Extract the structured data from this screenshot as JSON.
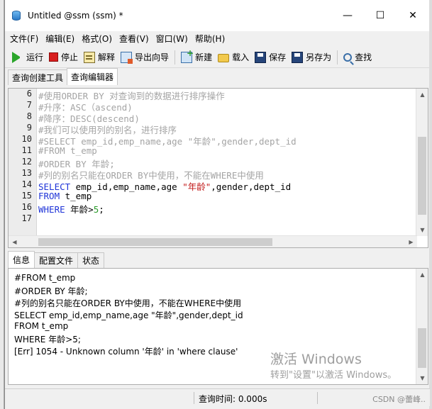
{
  "window": {
    "title": "Untitled @ssm (ssm) *",
    "minimize": "—",
    "maximize": "☐",
    "close": "✕"
  },
  "menu": [
    "文件(F)",
    "编辑(E)",
    "格式(O)",
    "查看(V)",
    "窗口(W)",
    "帮助(H)"
  ],
  "toolbar": {
    "run": "运行",
    "stop": "停止",
    "explain": "解释",
    "export_wizard": "导出向导",
    "new": "新建",
    "load": "载入",
    "save": "保存",
    "save_as": "另存为",
    "find": "查找"
  },
  "tabs": [
    "查询创建工具",
    "查询编辑器"
  ],
  "active_tab": "查询编辑器",
  "editor": {
    "lines": [
      {
        "no": "6",
        "text": "#使用ORDER BY 对查询到的数据进行排序操作"
      },
      {
        "no": "7",
        "text": "#升序：ASC（ascend)"
      },
      {
        "no": "8",
        "text": "#降序：DESC(descend)"
      },
      {
        "no": "9",
        "text": "#我们可以使用列的别名，进行排序"
      },
      {
        "no": "10",
        "text": "#SELECT emp_id,emp_name,age \"年龄\",gender,dept_id"
      },
      {
        "no": "11",
        "text": "#FROM t_emp"
      },
      {
        "no": "12",
        "text": "#ORDER BY 年龄;"
      },
      {
        "no": "13",
        "text": "#列的别名只能在ORDER BY中使用，不能在WHERE中使用"
      },
      {
        "no": "14",
        "select": "SELECT",
        "cols1": " emp_id,emp_name,age ",
        "alias": "\"年龄\"",
        "cols2": ",gender,dept_id"
      },
      {
        "no": "15",
        "from": "FROM",
        "table": " t_emp"
      },
      {
        "no": "16",
        "where": "WHERE",
        "cond": " 年龄>",
        "num": "5",
        "end": ";"
      },
      {
        "no": "17",
        "text": ""
      }
    ]
  },
  "bottom_tabs": [
    "信息",
    "配置文件",
    "状态"
  ],
  "messages": [
    "#FROM t_emp",
    "#ORDER BY 年龄;",
    "#列的别名只能在ORDER BY中使用，不能在WHERE中使用",
    "SELECT emp_id,emp_name,age \"年龄\",gender,dept_id",
    "FROM t_emp",
    "WHERE 年龄>5;",
    "[Err] 1054 - Unknown column '年龄' in 'where clause'"
  ],
  "watermark": {
    "line1": "激活 Windows",
    "line2": "转到\"设置\"以激活 Windows。"
  },
  "status": {
    "query_time": "查询时间: 0.000s",
    "credit": "CSDN @蕾峰.."
  }
}
